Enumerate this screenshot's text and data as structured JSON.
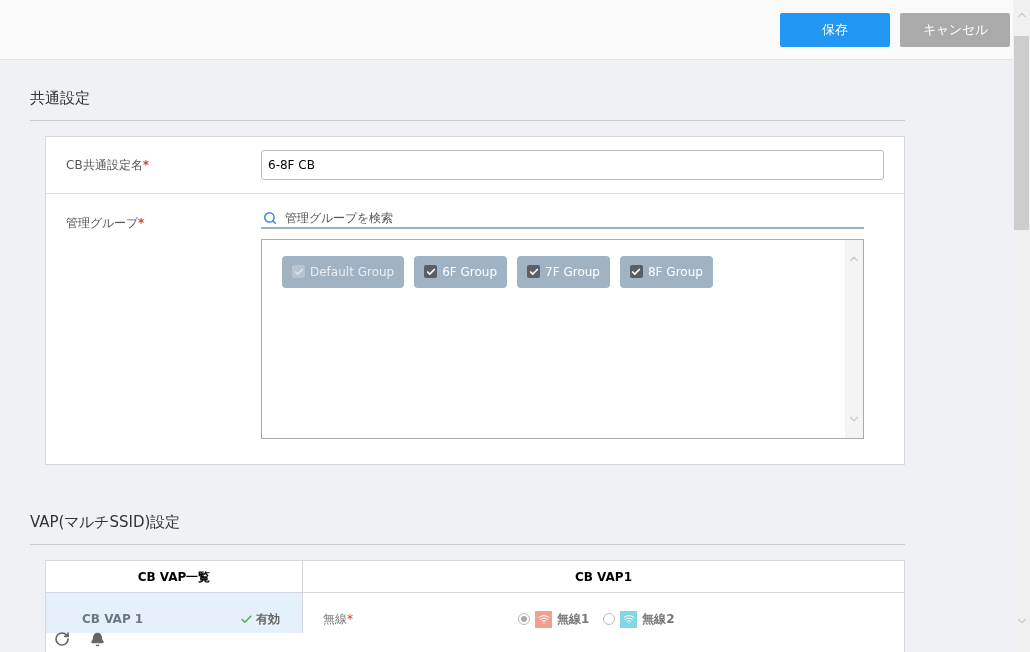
{
  "toolbar": {
    "buttons": [
      {
        "label": "保存",
        "kind": "primary"
      },
      {
        "label": "キャンセル",
        "kind": "secondary"
      }
    ]
  },
  "common": {
    "title": "共通設定",
    "name_field": {
      "label": "CB共通設定名",
      "required_mark": "*",
      "value": "6-8F CB"
    },
    "groups_field": {
      "label": "管理グループ",
      "required_mark": "*",
      "search_placeholder": "管理グループを検索",
      "groups": [
        {
          "label": "Default Group",
          "checked": true,
          "disabled": true
        },
        {
          "label": "6F Group",
          "checked": true,
          "disabled": false
        },
        {
          "label": "7F Group",
          "checked": true,
          "disabled": false
        },
        {
          "label": "8F Group",
          "checked": true,
          "disabled": false
        }
      ]
    }
  },
  "vap": {
    "title": "VAP(マルチSSID)設定",
    "list_header": "CB VAP一覧",
    "detail_header": "CB VAP1",
    "rows": [
      {
        "name": "CB VAP 1",
        "status": "有効",
        "selected": true
      }
    ],
    "radio_label": "無線",
    "required_mark": "*",
    "radios": [
      {
        "label": "無線1",
        "selected": true,
        "color": "#f0a090"
      },
      {
        "label": "無線2",
        "selected": false,
        "color": "#80d8e0"
      }
    ]
  }
}
